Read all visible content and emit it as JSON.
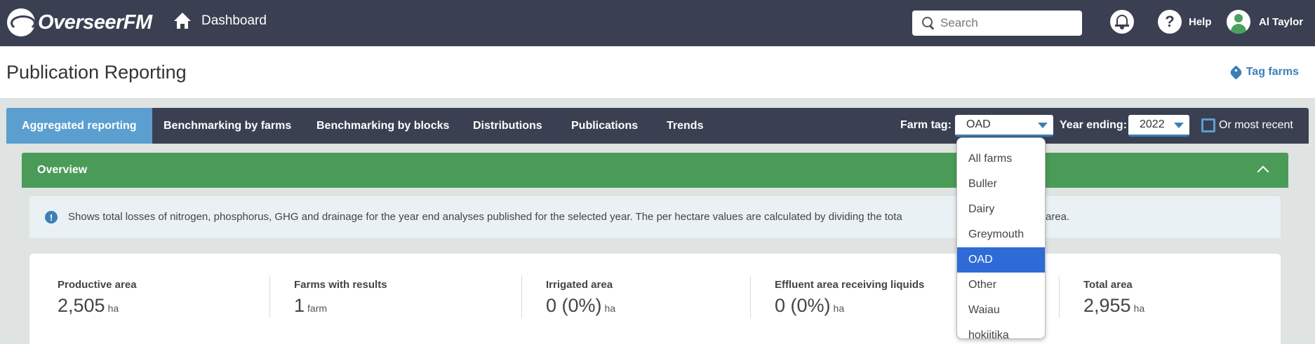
{
  "app": {
    "name": "OverseerFM"
  },
  "nav": {
    "home_label": "Dashboard",
    "search_placeholder": "Search",
    "help_label": "Help",
    "user_name": "Al Taylor"
  },
  "page": {
    "title": "Publication Reporting",
    "tag_farms_label": "Tag farms"
  },
  "tabs": [
    {
      "label": "Aggregated reporting",
      "active": true
    },
    {
      "label": "Benchmarking by farms"
    },
    {
      "label": "Benchmarking by blocks"
    },
    {
      "label": "Distributions"
    },
    {
      "label": "Publications"
    },
    {
      "label": "Trends"
    }
  ],
  "filters": {
    "farm_tag_label": "Farm tag:",
    "farm_tag_value": "OAD",
    "year_label": "Year ending:",
    "year_value": "2022",
    "most_recent_label": "Or most recent",
    "most_recent_checked": false
  },
  "dropdown": {
    "options": [
      "All farms",
      "Buller",
      "Dairy",
      "Greymouth",
      "OAD",
      "Other",
      "Waiau",
      "hokiitika"
    ],
    "selected": "OAD"
  },
  "overview": {
    "title": "Overview",
    "info_text": "Shows total losses of nitrogen, phosphorus, GHG and drainage for the year end analyses published for the selected year. The per hectare values are calculated by dividing the tota",
    "info_text_tail": "area."
  },
  "stats": [
    {
      "label": "Productive area",
      "value": "2,505",
      "unit": "ha"
    },
    {
      "label": "Farms with results",
      "value": "1",
      "unit": "farm"
    },
    {
      "label": "Irrigated area",
      "value": "0 (0%)",
      "unit": "ha"
    },
    {
      "label": "Effluent area receiving liquids",
      "value": "0 (0%)",
      "unit": "ha"
    },
    {
      "label": "Total area",
      "value": "2,955",
      "unit": "ha"
    }
  ],
  "colors": {
    "nav_bg": "#3a4051",
    "active_tab": "#5b9fd0",
    "overview_green": "#4a9b58",
    "link_blue": "#3c7fb5",
    "selected_option": "#2f6bd6"
  }
}
